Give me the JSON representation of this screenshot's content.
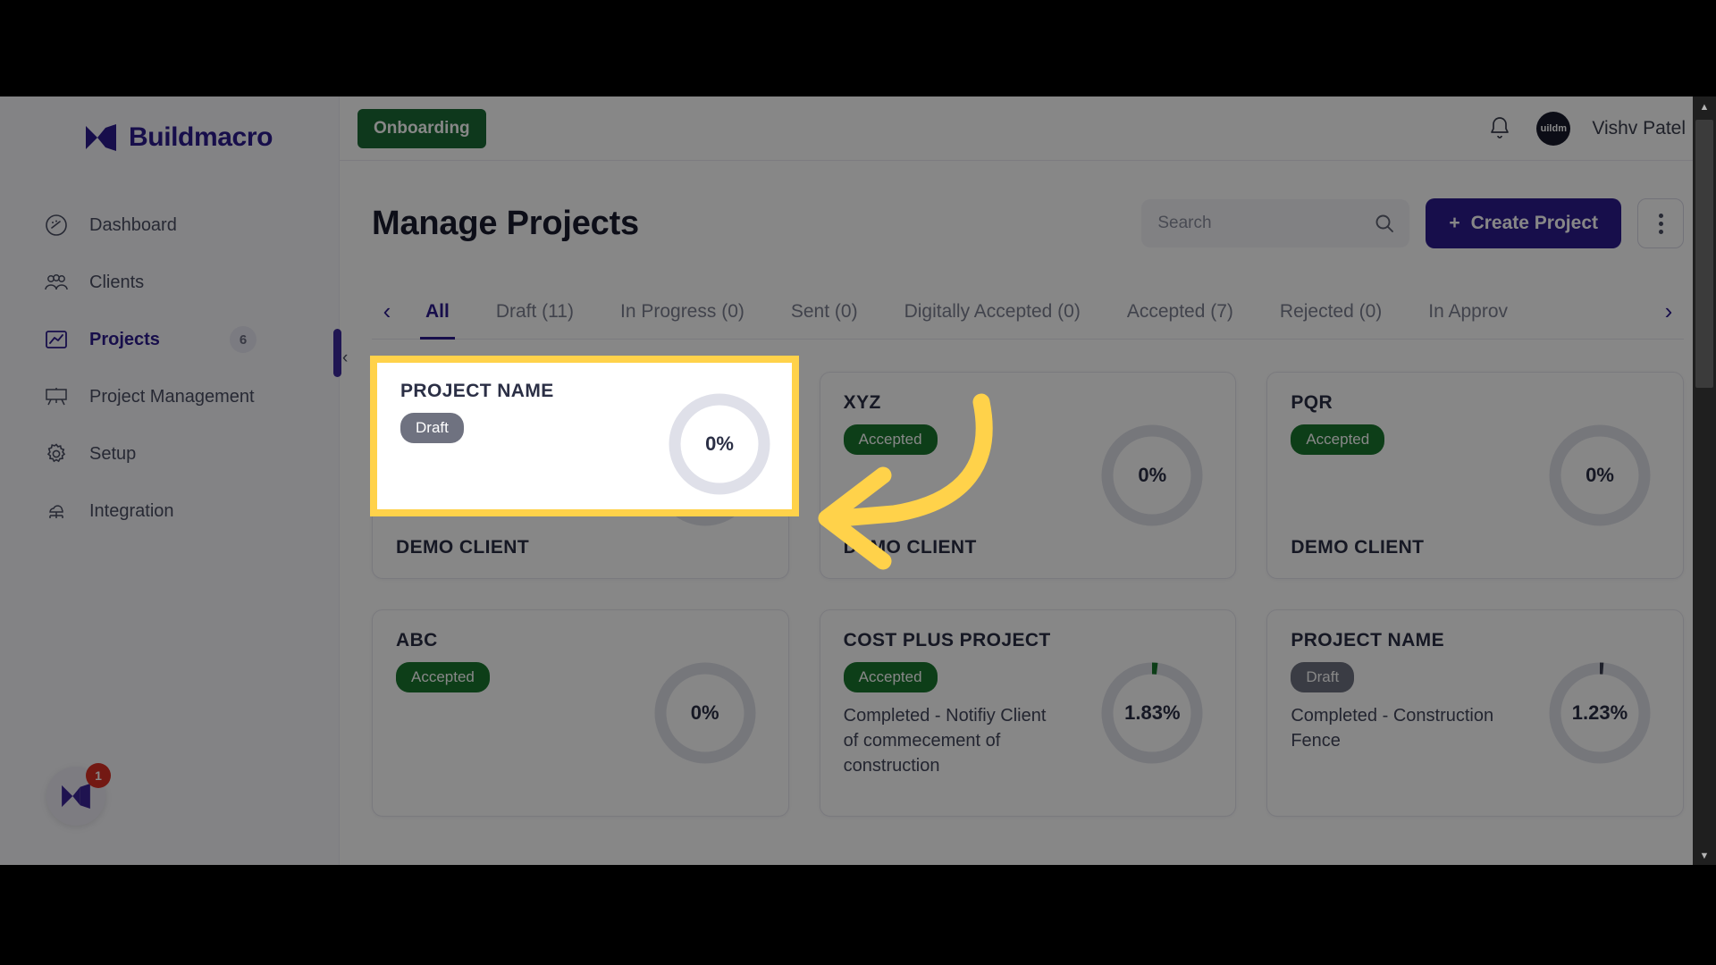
{
  "app": {
    "brand_name": "Buildmacro",
    "brand_icon": "buildmacro-logo-icon"
  },
  "sidebar": {
    "items": [
      {
        "label": "Dashboard",
        "icon": "speedometer-icon",
        "badge": ""
      },
      {
        "label": "Clients",
        "icon": "people-group-icon",
        "badge": ""
      },
      {
        "label": "Projects",
        "icon": "chart-line-icon",
        "badge": "6"
      },
      {
        "label": "Project Management",
        "icon": "presentation-board-icon",
        "badge": ""
      },
      {
        "label": "Setup",
        "icon": "gear-icon",
        "badge": ""
      },
      {
        "label": "Integration",
        "icon": "cloud-network-icon",
        "badge": ""
      }
    ],
    "active_index": 2,
    "floating_widget": {
      "icon": "buildmacro-logo-icon",
      "badge": "1"
    },
    "collapse_icon": "chevron-left-icon"
  },
  "topbar": {
    "onboarding_label": "Onboarding",
    "bell_icon": "bell-icon",
    "avatar_text": "uildm",
    "username": "Vishv Patel"
  },
  "header": {
    "title": "Manage Projects",
    "search": {
      "value": "",
      "placeholder": "Search",
      "icon": "search-icon"
    },
    "create_button": {
      "label": "Create Project",
      "icon": "plus-icon",
      "color": "#2d1b8e"
    },
    "kebab_icon": "more-vertical-icon"
  },
  "tabs": {
    "prev_icon": "chevron-left-icon",
    "next_icon": "chevron-right-icon",
    "active": "All",
    "items": [
      {
        "label": "All"
      },
      {
        "label": "Draft (11)"
      },
      {
        "label": "In Progress (0)"
      },
      {
        "label": "Sent (0)"
      },
      {
        "label": "Digitally Accepted (0)"
      },
      {
        "label": "Accepted (7)"
      },
      {
        "label": "Rejected (0)"
      },
      {
        "label": "In Approv"
      }
    ]
  },
  "highlight": {
    "name": "PROJECT NAME",
    "status": "Draft",
    "progress_label": "0%",
    "border_color": "#ffd24a"
  },
  "annotation": {
    "arrow_color": "#ffd24a",
    "arrow_icon": "curved-arrow-left-icon"
  },
  "projects": [
    {
      "name": "PROJECT NAME",
      "status": "Draft",
      "status_type": "draft",
      "note": "",
      "client": "DEMO CLIENT",
      "progress_label": "0%",
      "progress": 0
    },
    {
      "name": "XYZ",
      "status": "Accepted",
      "status_type": "accepted",
      "note": "",
      "client": "DEMO CLIENT",
      "progress_label": "0%",
      "progress": 0
    },
    {
      "name": "PQR",
      "status": "Accepted",
      "status_type": "accepted",
      "note": "",
      "client": "DEMO CLIENT",
      "progress_label": "0%",
      "progress": 0
    },
    {
      "name": "ABC",
      "status": "Accepted",
      "status_type": "accepted",
      "note": "",
      "client": "",
      "progress_label": "0%",
      "progress": 0
    },
    {
      "name": "COST PLUS PROJECT",
      "status": "Accepted",
      "status_type": "accepted",
      "note": "Completed - Notifiy Client of commecement of construction",
      "client": "",
      "progress_label": "1.83%",
      "progress": 1.83
    },
    {
      "name": "PROJECT NAME",
      "status": "Draft",
      "status_type": "draft",
      "note": "Completed - Construction Fence",
      "client": "",
      "progress_label": "1.23%",
      "progress": 1.23
    }
  ],
  "scrollbar": {
    "up_icon": "triangle-up-icon",
    "down_icon": "triangle-down-icon"
  }
}
